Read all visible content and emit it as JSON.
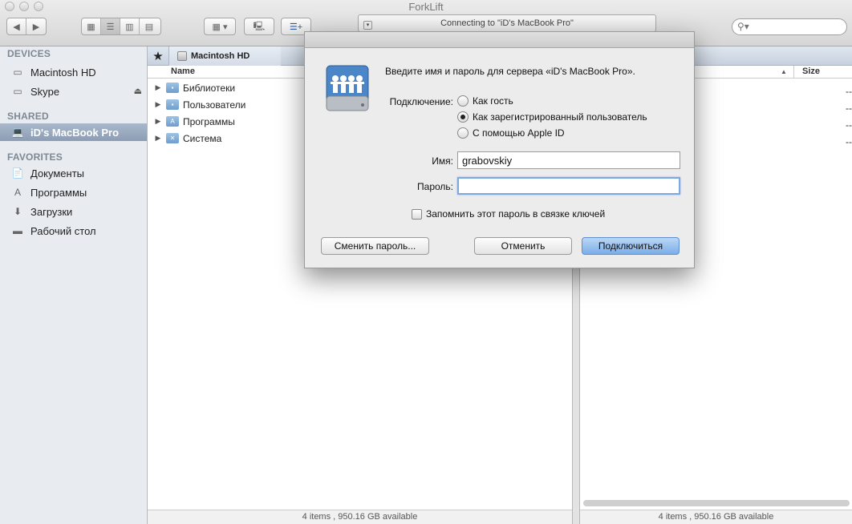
{
  "window": {
    "title": "ForkLift"
  },
  "toolbar": {
    "status_text": "Connecting to \"iD's MacBook Pro\""
  },
  "sidebar": {
    "sections": {
      "devices": "DEVICES",
      "shared": "SHARED",
      "favorites": "FAVORITES"
    },
    "devices": [
      {
        "label": "Macintosh HD",
        "icon": "hard-disk-icon"
      },
      {
        "label": "Skype",
        "icon": "disk-image-icon"
      }
    ],
    "shared": [
      {
        "label": "iD's MacBook Pro",
        "icon": "laptop-icon",
        "selected": true
      }
    ],
    "favorites": [
      {
        "label": "Документы",
        "icon": "documents-icon"
      },
      {
        "label": "Программы",
        "icon": "applications-icon"
      },
      {
        "label": "Загрузки",
        "icon": "downloads-icon"
      },
      {
        "label": "Рабочий стол",
        "icon": "desktop-icon"
      }
    ]
  },
  "left_pane": {
    "crumb": "Macintosh HD",
    "column_name": "Name",
    "rows": [
      {
        "name": "Библиотеки"
      },
      {
        "name": "Пользователи"
      },
      {
        "name": "Программы"
      },
      {
        "name": "Система"
      }
    ],
    "footer": "4 items , 950.16 GB available"
  },
  "right_pane": {
    "column_size": "Size",
    "dashes": [
      "--",
      "--",
      "--",
      "--"
    ],
    "footer": "4 items , 950.16 GB available"
  },
  "dialog": {
    "message": "Введите имя и пароль для сервера «iD's MacBook Pro».",
    "connection_label": "Подключение:",
    "radio_guest": "Как гость",
    "radio_registered": "Как зарегистрированный пользователь",
    "radio_appleid": "С помощью Apple ID",
    "selected_option": "registered",
    "name_label": "Имя:",
    "name_value": "grabovskiy",
    "password_label": "Пароль:",
    "password_value": "",
    "remember_label": "Запомнить этот пароль в связке ключей",
    "remember_checked": false,
    "change_password_button": "Сменить пароль...",
    "cancel_button": "Отменить",
    "connect_button": "Подключиться"
  },
  "colors": {
    "sidebar_bg": "#e8ecf1",
    "selection": "#8c9db4",
    "primary_button": "#7aaee8"
  }
}
